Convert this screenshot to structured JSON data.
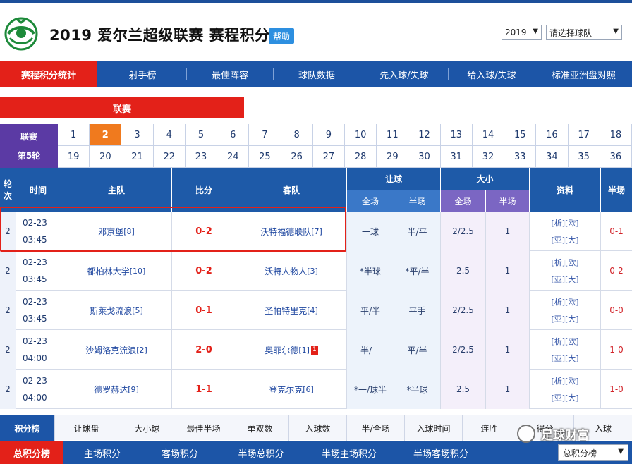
{
  "header": {
    "title": "2019 爱尔兰超级联赛 赛程积分",
    "help_badge": "帮助",
    "year_select": "2019",
    "team_select": "请选择球队"
  },
  "nav": [
    {
      "label": "赛程积分统计",
      "active": true
    },
    {
      "label": "射手榜",
      "active": false
    },
    {
      "label": "最佳阵容",
      "active": false
    },
    {
      "label": "球队数据",
      "active": false
    },
    {
      "label": "先入球/失球",
      "active": false
    },
    {
      "label": "给入球/失球",
      "active": false
    },
    {
      "label": "标准亚洲盘对照",
      "active": false
    }
  ],
  "league_bar": "联赛",
  "rounds": {
    "label_top": "联赛",
    "label_bottom": "第5轮",
    "row1": [
      "1",
      "2",
      "3",
      "4",
      "5",
      "6",
      "7",
      "8",
      "9",
      "10",
      "11",
      "12",
      "13",
      "14",
      "15",
      "16",
      "17",
      "18"
    ],
    "row2": [
      "19",
      "20",
      "21",
      "22",
      "23",
      "24",
      "25",
      "26",
      "27",
      "28",
      "29",
      "30",
      "31",
      "32",
      "33",
      "34",
      "35",
      "36"
    ],
    "active_index": 1
  },
  "table": {
    "headers": {
      "round": "轮次",
      "time": "时间",
      "home": "主队",
      "score": "比分",
      "away": "客队",
      "handicap": "让球",
      "handicap_full": "全场",
      "handicap_half": "半场",
      "overunder": "大小",
      "ou_full": "全场",
      "ou_half": "半场",
      "data": "资料",
      "half": "半场"
    },
    "rows": [
      {
        "round": "2",
        "date": "02-23",
        "time": "03:45",
        "home": "邓京堡",
        "home_rank": "[8]",
        "score": "0-2",
        "away": "沃特福德联队",
        "away_rank": "[7]",
        "hcp_full": "一球",
        "hcp_half": "半/平",
        "ou_full": "2/2.5",
        "ou_half": "1",
        "data1": "[析][欧]",
        "data2": "[亚][大]",
        "half": "0-1",
        "red_card": ""
      },
      {
        "round": "2",
        "date": "02-23",
        "time": "03:45",
        "home": "都柏林大学",
        "home_rank": "[10]",
        "score": "0-2",
        "away": "沃特人物人",
        "away_rank": "[3]",
        "hcp_full": "*半球",
        "hcp_half": "*平/半",
        "ou_full": "2.5",
        "ou_half": "1",
        "data1": "[析][欧]",
        "data2": "[亚][大]",
        "half": "0-2",
        "red_card": ""
      },
      {
        "round": "2",
        "date": "02-23",
        "time": "03:45",
        "home": "斯莱戈流浪",
        "home_rank": "[5]",
        "score": "0-1",
        "away": "圣帕特里克",
        "away_rank": "[4]",
        "hcp_full": "平/半",
        "hcp_half": "平手",
        "ou_full": "2/2.5",
        "ou_half": "1",
        "data1": "[析][欧]",
        "data2": "[亚][大]",
        "half": "0-0",
        "red_card": ""
      },
      {
        "round": "2",
        "date": "02-23",
        "time": "04:00",
        "home": "沙姆洛克流浪",
        "home_rank": "[2]",
        "score": "2-0",
        "away": "奥菲尔德",
        "away_rank": "[1]",
        "hcp_full": "半/一",
        "hcp_half": "平/半",
        "ou_full": "2/2.5",
        "ou_half": "1",
        "data1": "[析][欧]",
        "data2": "[亚][大]",
        "half": "1-0",
        "red_card": "1"
      },
      {
        "round": "2",
        "date": "02-23",
        "time": "04:00",
        "home": "德罗赫达",
        "home_rank": "[9]",
        "score": "1-1",
        "away": "登克尔克",
        "away_rank": "[6]",
        "hcp_full": "*一/球半",
        "hcp_half": "*半球",
        "ou_full": "2.5",
        "ou_half": "1",
        "data1": "[析][欧]",
        "data2": "[亚][大]",
        "half": "1-0",
        "red_card": ""
      }
    ]
  },
  "tabs_secondary": [
    {
      "label": "积分榜",
      "active": true
    },
    {
      "label": "让球盘",
      "active": false
    },
    {
      "label": "大小球",
      "active": false
    },
    {
      "label": "最佳半场",
      "active": false
    },
    {
      "label": "单双数",
      "active": false
    },
    {
      "label": "入球数",
      "active": false
    },
    {
      "label": "半/全场",
      "active": false
    },
    {
      "label": "入球时间",
      "active": false
    },
    {
      "label": "连胜",
      "active": false
    },
    {
      "label": "得分",
      "active": false
    },
    {
      "label": "入球",
      "active": false
    }
  ],
  "tabs_tertiary": [
    {
      "label": "总积分榜",
      "active": true
    },
    {
      "label": "主场积分",
      "active": false
    },
    {
      "label": "客场积分",
      "active": false
    },
    {
      "label": "半场总积分",
      "active": false
    },
    {
      "label": "半场主场积分",
      "active": false
    },
    {
      "label": "半场客场积分",
      "active": false
    }
  ],
  "score_select": "总积分榜",
  "watermark": "足球财富",
  "colors": {
    "nav_blue": "#1c55a7",
    "active_red": "#e32119",
    "round_purple": "#5b3aa4",
    "round_active": "#f07a1e"
  }
}
